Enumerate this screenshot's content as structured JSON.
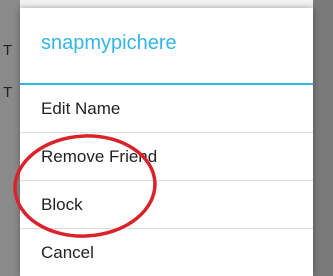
{
  "background": {
    "peek_text_1": "T",
    "peek_text_2": "T"
  },
  "dialog": {
    "title": "snapmypichere",
    "items": [
      {
        "label": "Edit Name"
      },
      {
        "label": "Remove Friend"
      },
      {
        "label": "Block"
      },
      {
        "label": "Cancel"
      }
    ]
  },
  "colors": {
    "accent": "#33b5e5",
    "annotation_circle": "#d9222a"
  }
}
